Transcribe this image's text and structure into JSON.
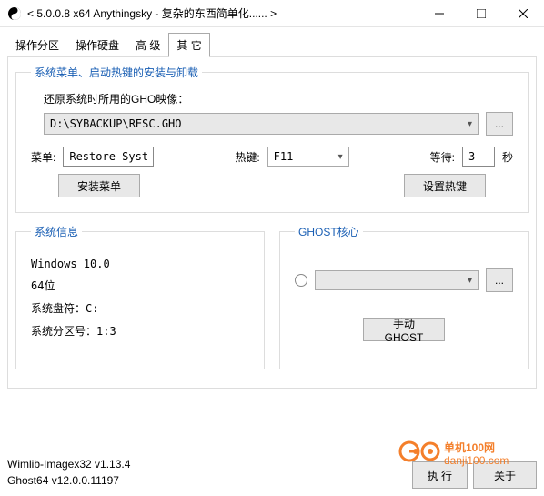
{
  "window": {
    "title": "< 5.0.0.8 x64 Anythingsky - 复杂的东西简单化...... >"
  },
  "tabs": {
    "t1": "操作分区",
    "t2": "操作硬盘",
    "t3": "高 级",
    "t4": "其 它"
  },
  "group1": {
    "legend": "系统菜单、启动热键的安装与卸载",
    "gho_label": "还原系统时所用的GHO映像：",
    "gho_path": "D:\\SYBACKUP\\RESC.GHO",
    "browse": "...",
    "menu_label": "菜单:",
    "menu_value": "Restore System",
    "hotkey_label": "热键:",
    "hotkey_value": "F11",
    "wait_label": "等待:",
    "wait_value": "3",
    "wait_unit": "秒",
    "install_menu": "安装菜单",
    "set_hotkey": "设置热键"
  },
  "sysinfo": {
    "legend": "系统信息",
    "os": "Windows 10.0",
    "arch": "64位",
    "drive_label": "系统盘符：C:",
    "partition_label": "系统分区号：1:3"
  },
  "ghost": {
    "legend": "GHOST核心",
    "browse": "...",
    "manual": "手动GHOST"
  },
  "footer": {
    "line1": "Wimlib-Imagex32 v1.13.4",
    "line2": "Ghost64 v12.0.0.11197",
    "exec": "执 行",
    "about": "关于"
  },
  "watermark": {
    "text": "单机100网",
    "url": "danji100.com"
  }
}
